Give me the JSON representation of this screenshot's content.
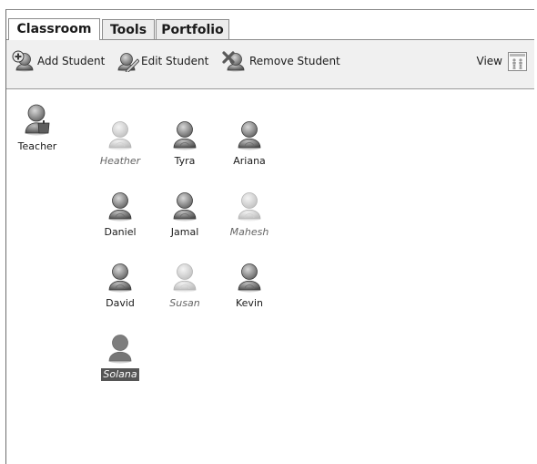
{
  "tabs": [
    "Classroom",
    "Tools",
    "Portfolio"
  ],
  "toolbar": {
    "add": "Add Student",
    "edit": "Edit Student",
    "remove": "Remove Student",
    "view": "View"
  },
  "teacher": {
    "label": "Teacher"
  },
  "students": [
    {
      "name": "Heather",
      "status": "absent"
    },
    {
      "name": "Tyra",
      "status": "present"
    },
    {
      "name": "Ariana",
      "status": "present"
    },
    {
      "name": "Daniel",
      "status": "present"
    },
    {
      "name": "Jamal",
      "status": "present"
    },
    {
      "name": "Mahesh",
      "status": "absent"
    },
    {
      "name": "David",
      "status": "present"
    },
    {
      "name": "Susan",
      "status": "absent"
    },
    {
      "name": "Kevin",
      "status": "present"
    },
    {
      "name": "Solana",
      "status": "selected"
    }
  ],
  "colors": {
    "present": "#8a8a8a",
    "absent": "#d6d6d6",
    "selected": "#7a7a7a"
  }
}
